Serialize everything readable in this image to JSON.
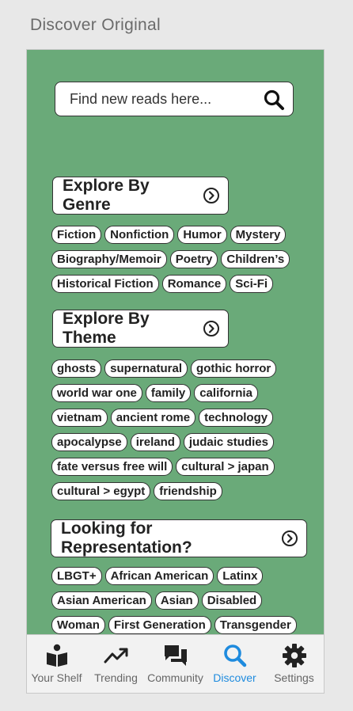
{
  "page_title": "Discover Original",
  "search": {
    "placeholder": "Find new reads here..."
  },
  "sections": {
    "genre": {
      "label": "Explore By Genre",
      "tags": [
        "Fiction",
        "Nonfiction",
        "Humor",
        "Mystery",
        "Biography/Memoir",
        "Poetry",
        "Children’s",
        "Historical Fiction",
        "Romance",
        "Sci-Fi"
      ]
    },
    "theme": {
      "label": "Explore By Theme",
      "tags": [
        "ghosts",
        "supernatural",
        "gothic horror",
        "world war one",
        "family",
        "california",
        "vietnam",
        "ancient rome",
        "technology",
        "apocalypse",
        "ireland",
        "judaic studies",
        "fate versus free will",
        "cultural > japan",
        "cultural > egypt",
        "friendship"
      ]
    },
    "representation": {
      "label": "Looking for Representation?",
      "tags": [
        "LBGT+",
        "African American",
        "Latinx",
        "Asian American",
        "Asian",
        "Disabled",
        "Woman",
        "First Generation",
        "Transgender"
      ]
    }
  },
  "tabbar": {
    "items": [
      {
        "label": "Your Shelf",
        "icon": "book-reader-icon"
      },
      {
        "label": "Trending",
        "icon": "trending-up-icon"
      },
      {
        "label": "Community",
        "icon": "chat-bubbles-icon"
      },
      {
        "label": "Discover",
        "icon": "search-icon"
      },
      {
        "label": "Settings",
        "icon": "gear-icon"
      }
    ],
    "active": "Discover",
    "active_color": "#1e8bde"
  },
  "colors": {
    "background": "#6aaa79",
    "accent": "#1e8bde"
  }
}
